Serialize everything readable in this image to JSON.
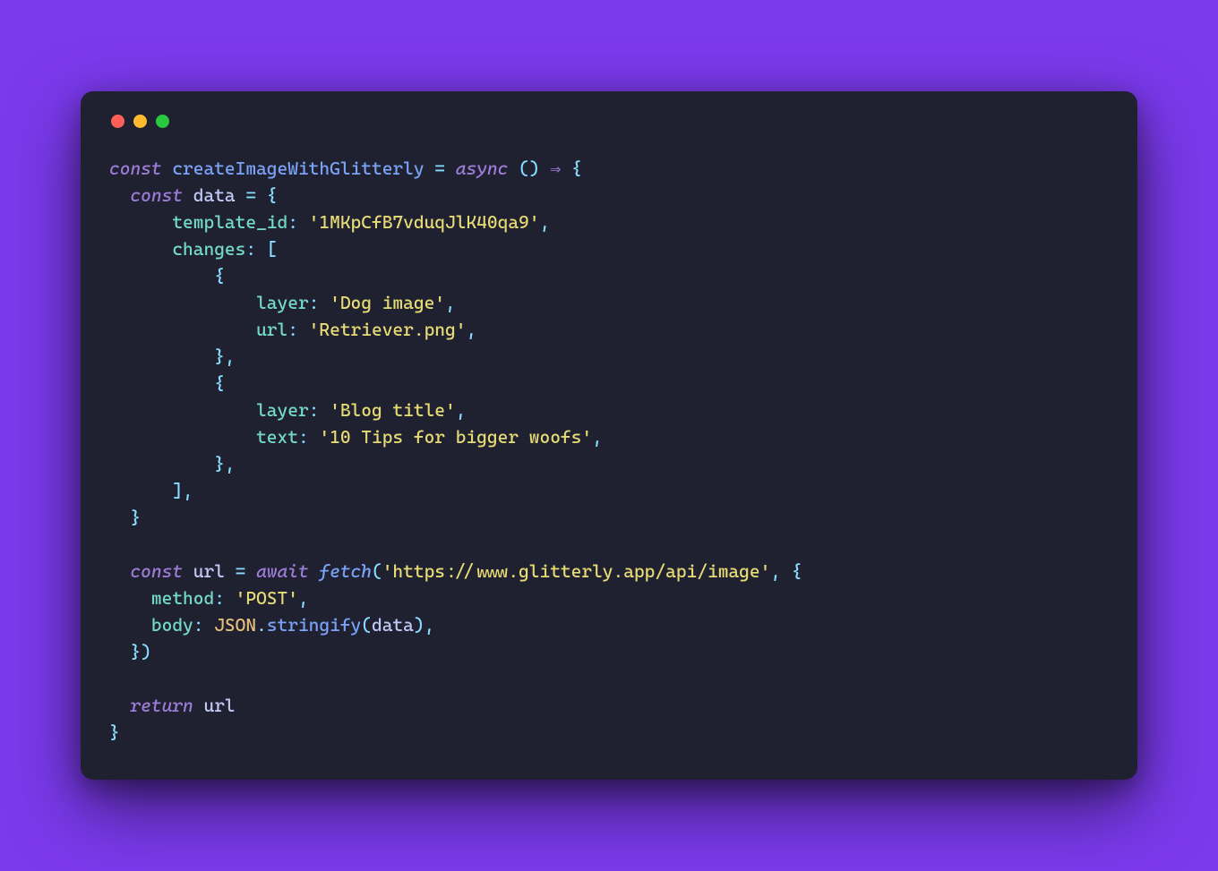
{
  "code": {
    "kw_const": "const",
    "kw_async": "async",
    "kw_await": "await",
    "kw_return": "return",
    "fn_name": "createImageWithGlitterly",
    "var_data": "data",
    "var_url": "url",
    "prop_template_id": "template_id",
    "prop_changes": "changes",
    "prop_layer": "layer",
    "prop_url": "url",
    "prop_text": "text",
    "prop_method": "method",
    "prop_body": "body",
    "str_template_id": "'1MKpCfB7vduqJlK40qa9'",
    "str_layer1": "'Dog image'",
    "str_url1": "'Retriever.png'",
    "str_layer2": "'Blog title'",
    "str_text2": "'10 Tips for bigger woofs'",
    "str_api_url": "'https://www.glitterly.app/api/image'",
    "str_post": "'POST'",
    "fn_fetch": "fetch",
    "cls_json": "JSON",
    "fn_stringify": "stringify",
    "arrow": "⇒",
    "eq": "=",
    "colon": ":",
    "comma": ",",
    "dot": ".",
    "lparen": "(",
    "rparen": ")",
    "lbrace": "{",
    "rbrace": "}",
    "lbracket": "[",
    "rbracket": "]"
  }
}
